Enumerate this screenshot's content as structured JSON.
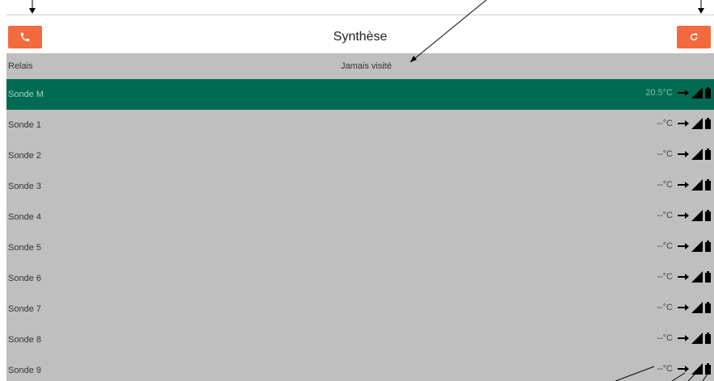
{
  "header": {
    "title": "Synthèse",
    "left_button_icon": "phone-icon",
    "right_button_icon": "refresh-icon",
    "button_color": "#f26a3d"
  },
  "subheader": {
    "left": "Relais",
    "middle": "Jamais visité"
  },
  "colors": {
    "active_row": "#006b52",
    "row_bg": "#bfbfbf"
  },
  "rows": [
    {
      "name": "Sonde M",
      "temp": "20.5°C",
      "active": true
    },
    {
      "name": "Sonde 1",
      "temp": "--°C",
      "active": false
    },
    {
      "name": "Sonde 2",
      "temp": "--°C",
      "active": false
    },
    {
      "name": "Sonde 3",
      "temp": "--°C",
      "active": false
    },
    {
      "name": "Sonde 4",
      "temp": "--°C",
      "active": false
    },
    {
      "name": "Sonde 5",
      "temp": "--°C",
      "active": false
    },
    {
      "name": "Sonde 6",
      "temp": "--°C",
      "active": false
    },
    {
      "name": "Sonde 7",
      "temp": "--°C",
      "active": false
    },
    {
      "name": "Sonde 8",
      "temp": "--°C",
      "active": false
    },
    {
      "name": "Sonde 9",
      "temp": "--°C",
      "active": false
    }
  ]
}
